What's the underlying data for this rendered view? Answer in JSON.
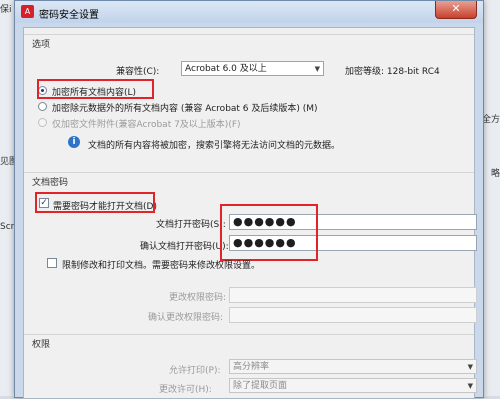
{
  "window": {
    "title": "密码安全设置",
    "close_label": "✕"
  },
  "background": {
    "left_fragments": [
      "保i",
      "见图",
      "Scr"
    ],
    "right_fragments": [
      "全方",
      "略"
    ]
  },
  "options": {
    "section_title": "选项",
    "compat_label": "兼容性(C):",
    "compat_value": "Acrobat 6.0 及以上",
    "encrypt_level": "加密等级: 128-bit RC4",
    "radio1": "加密所有文档内容(L)",
    "radio2": "加密除元数据外的所有文档内容 (兼容 Acrobat 6 及后续版本) (M)",
    "radio3": "仅加密文件附件(兼容Acrobat 7及以上版本)(F)",
    "info_text": "文档的所有内容将被加密，搜索引擎将无法访问文档的元数据。"
  },
  "doc_password": {
    "section_title": "文档密码",
    "require_label": "需要密码才能打开文档(D)",
    "open_pw_label": "文档打开密码(S):",
    "open_pw_value": "●●●●●●",
    "confirm_pw_label": "确认文档打开密码(U):",
    "confirm_pw_value": "●●●●●●",
    "restrict_label": "限制修改和打印文档。需要密码来修改权限设置。",
    "change_pw_label": "更改权限密码:",
    "confirm_change_pw_label": "确认更改权限密码:"
  },
  "permissions": {
    "section_title": "权限",
    "print_label": "允许打印(P):",
    "print_value": "高分辨率",
    "change_label": "更改许可(H):",
    "change_value": "除了提取页面"
  },
  "colors": {
    "highlight": "#e0252a",
    "accent": "#2d73c8"
  }
}
